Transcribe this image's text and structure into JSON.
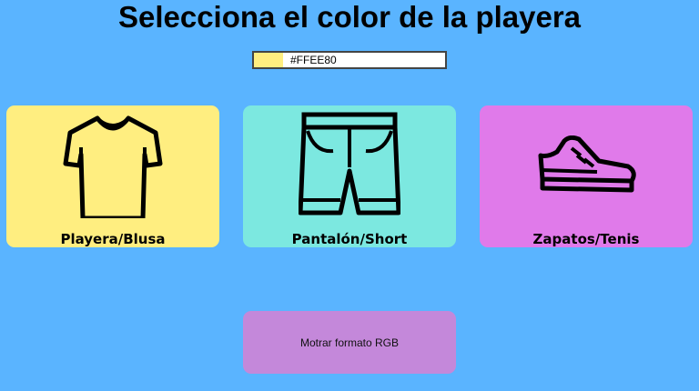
{
  "page": {
    "title": "Selecciona el color de la playera",
    "background": "#5AB4FF"
  },
  "color_picker": {
    "value": "#FFEE80",
    "swatch_color": "#FFEE80"
  },
  "cards": [
    {
      "label": "Playera/Blusa",
      "icon": "tshirt-icon",
      "color": "#FFEE80"
    },
    {
      "label": "Pantalón/Short",
      "icon": "shorts-icon",
      "color": "#7CE8E0"
    },
    {
      "label": "Zapatos/Tenis",
      "icon": "sneaker-icon",
      "color": "#E07AEA"
    }
  ],
  "rgb_button": {
    "label": "Motrar formato RGB",
    "color": "#C488DA"
  }
}
